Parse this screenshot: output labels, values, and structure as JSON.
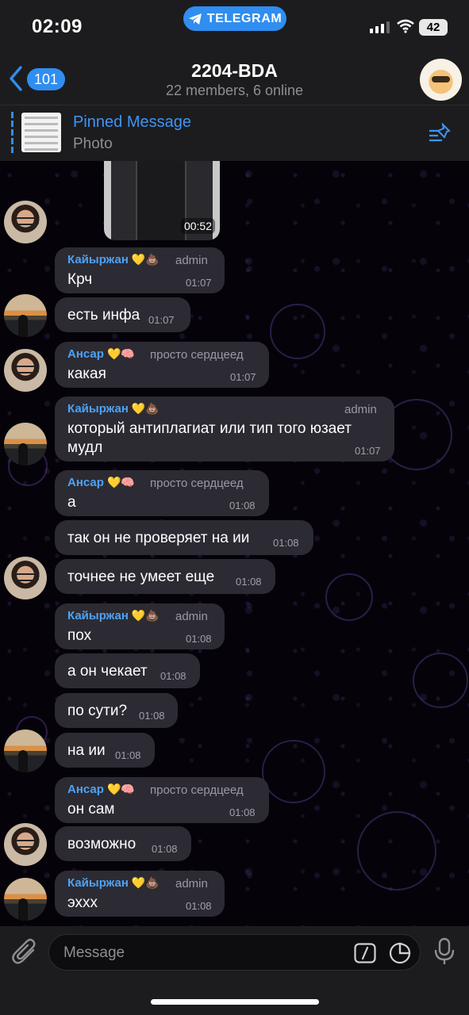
{
  "status_bar": {
    "time": "02:09",
    "app_pill": "TELEGRAM",
    "battery": "42"
  },
  "header": {
    "back_count": "101",
    "title": "2204-BDA",
    "subtitle": "22 members, 6 online"
  },
  "pinned": {
    "title": "Pinned Message",
    "subtitle": "Photo"
  },
  "video": {
    "duration": "00:52"
  },
  "messages": [
    {
      "sender": "Кайыржан",
      "emoji": "💛💩",
      "role": "admin",
      "text": "Крч",
      "time": "01:07"
    },
    {
      "text": "есть инфа",
      "time": "01:07"
    },
    {
      "sender": "Ансар",
      "emoji": "💛🧠",
      "role": "просто сердцеед",
      "text": "какая",
      "time": "01:07"
    },
    {
      "sender": "Кайыржан",
      "emoji": "💛💩",
      "role": "admin",
      "text_line1": "который антиплагиат или тип того юзает",
      "text_line2": "мудл",
      "time": "01:07"
    },
    {
      "sender": "Ансар",
      "emoji": "💛🧠",
      "role": "просто сердцеед",
      "text": "а",
      "time": "01:08"
    },
    {
      "text": "так он не проверяет на ии",
      "time": "01:08"
    },
    {
      "text": "точнее не умеет еще",
      "time": "01:08"
    },
    {
      "sender": "Кайыржан",
      "emoji": "💛💩",
      "role": "admin",
      "text": "пох",
      "time": "01:08"
    },
    {
      "text": "а он чекает",
      "time": "01:08"
    },
    {
      "text": "по сути?",
      "time": "01:08"
    },
    {
      "text": "на ии",
      "time": "01:08"
    },
    {
      "sender": "Ансар",
      "emoji": "💛🧠",
      "role": "просто сердцеед",
      "text": "он сам",
      "time": "01:08"
    },
    {
      "text": "возможно",
      "time": "01:08"
    },
    {
      "sender": "Кайыржан",
      "emoji": "💛💩",
      "role": "admin",
      "text": "эххх",
      "time": "01:08"
    }
  ],
  "input": {
    "placeholder": "Message"
  },
  "colors": {
    "accent": "#2f8ef0",
    "bubble": "#2c2b33",
    "sender": "#4ea2f4"
  },
  "icons": [
    "back-chevron-icon",
    "telegram-icon",
    "signal-icon",
    "wifi-icon",
    "pin-list-icon",
    "attach-icon",
    "command-icon",
    "sticker-icon",
    "mic-icon"
  ]
}
